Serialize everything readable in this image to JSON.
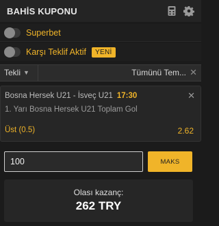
{
  "header": {
    "title": "BAHİS KUPONU",
    "icons": [
      "calculator-icon",
      "gear-icon"
    ]
  },
  "toggles": [
    {
      "label": "Superbet",
      "on": false
    },
    {
      "label": "Karşı Teklif Aktif",
      "on": false,
      "badge": "YENİ"
    }
  ],
  "tabs": {
    "single": "Tekli",
    "clear_all": "Tümünü Tem..."
  },
  "bet": {
    "match": "Bosna Hersek U21 - İsveç U21",
    "time": "17:30",
    "market": "1. Yarı Bosna Hersek U21 Toplam Gol",
    "selection": "Üst (0.5)",
    "odds": "2.62"
  },
  "stake": {
    "value": "100",
    "max_label": "MAKS"
  },
  "winnings": {
    "label": "Olası kazanç:",
    "amount": "262 TRY"
  },
  "colors": {
    "accent": "#f0b429",
    "background": "#1b1b1b",
    "panel": "#262626"
  }
}
